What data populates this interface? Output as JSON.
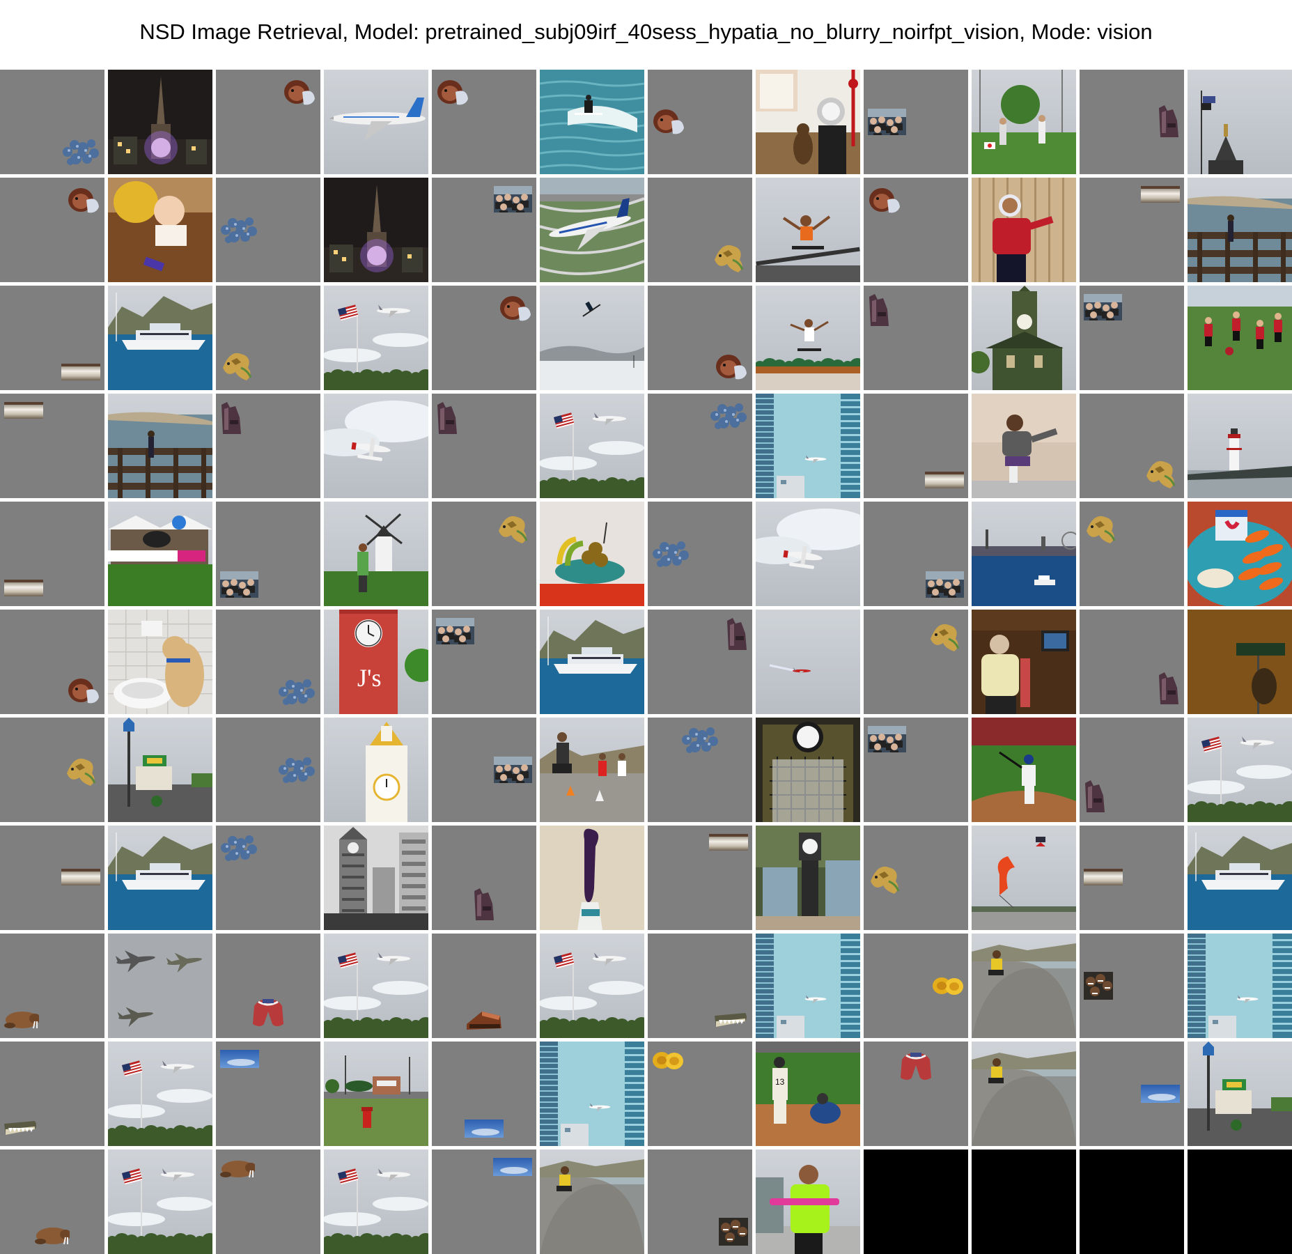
{
  "title": "NSD Image Retrieval, Model: pretrained_subj09irf_40sess_hypatia_no_blurry_noirfpt_vision, Mode: vision",
  "grid": {
    "rows": 11,
    "cols": 12,
    "cells": [
      {
        "kind": "stimulus",
        "obj": "blue-blob",
        "pos": "bottom-right"
      },
      {
        "kind": "retrieved",
        "scene": "night-spire"
      },
      {
        "kind": "stimulus",
        "obj": "baby-face",
        "pos": "top-right"
      },
      {
        "kind": "retrieved",
        "scene": "airliner-gray-sky"
      },
      {
        "kind": "stimulus",
        "obj": "baby-face",
        "pos": "top-left"
      },
      {
        "kind": "retrieved",
        "scene": "surfer-wave"
      },
      {
        "kind": "stimulus",
        "obj": "baby-face",
        "pos": "middle-left"
      },
      {
        "kind": "retrieved",
        "scene": "cat-clock-room"
      },
      {
        "kind": "stimulus",
        "obj": "crowd-photo",
        "pos": "middle-left"
      },
      {
        "kind": "retrieved",
        "scene": "frisbee-park"
      },
      {
        "kind": "stimulus",
        "obj": "maroon-shape",
        "pos": "middle-right"
      },
      {
        "kind": "retrieved",
        "scene": "flag-statue-sky"
      },
      {
        "kind": "stimulus",
        "obj": "baby-face",
        "pos": "top-right"
      },
      {
        "kind": "retrieved",
        "scene": "baby-floor"
      },
      {
        "kind": "stimulus",
        "obj": "blue-blob",
        "pos": "middle-left"
      },
      {
        "kind": "retrieved",
        "scene": "night-spire"
      },
      {
        "kind": "stimulus",
        "obj": "crowd-photo",
        "pos": "top-right"
      },
      {
        "kind": "retrieved",
        "scene": "airliner-runway"
      },
      {
        "kind": "stimulus",
        "obj": "gold-dragon",
        "pos": "bottom-right"
      },
      {
        "kind": "retrieved",
        "scene": "skateboarder-rail"
      },
      {
        "kind": "stimulus",
        "obj": "baby-face",
        "pos": "top-left"
      },
      {
        "kind": "retrieved",
        "scene": "boy-red-shirt"
      },
      {
        "kind": "stimulus",
        "obj": "metal-bar",
        "pos": "top-right"
      },
      {
        "kind": "retrieved",
        "scene": "person-fence-sea"
      },
      {
        "kind": "stimulus",
        "obj": "metal-bar",
        "pos": "bottom-right"
      },
      {
        "kind": "retrieved",
        "scene": "yacht-harbor"
      },
      {
        "kind": "stimulus",
        "obj": "gold-dragon",
        "pos": "bottom-left"
      },
      {
        "kind": "retrieved",
        "scene": "flag-plane-sky"
      },
      {
        "kind": "stimulus",
        "obj": "baby-face",
        "pos": "top-right"
      },
      {
        "kind": "retrieved",
        "scene": "skier-air"
      },
      {
        "kind": "stimulus",
        "obj": "baby-face",
        "pos": "bottom-right"
      },
      {
        "kind": "retrieved",
        "scene": "skateboard-beach"
      },
      {
        "kind": "stimulus",
        "obj": "maroon-shape",
        "pos": "top-left"
      },
      {
        "kind": "retrieved",
        "scene": "clock-tower-green"
      },
      {
        "kind": "stimulus",
        "obj": "crowd-photo",
        "pos": "top-left"
      },
      {
        "kind": "retrieved",
        "scene": "kids-soccer"
      },
      {
        "kind": "stimulus",
        "obj": "metal-bar",
        "pos": "top-left"
      },
      {
        "kind": "retrieved",
        "scene": "person-fence-sea"
      },
      {
        "kind": "stimulus",
        "obj": "maroon-shape",
        "pos": "top-left"
      },
      {
        "kind": "retrieved",
        "scene": "seaplane-clouds"
      },
      {
        "kind": "stimulus",
        "obj": "maroon-shape",
        "pos": "top-left"
      },
      {
        "kind": "retrieved",
        "scene": "flag-plane-sky"
      },
      {
        "kind": "stimulus",
        "obj": "blue-blob",
        "pos": "top-right"
      },
      {
        "kind": "retrieved",
        "scene": "skyscraper-plane"
      },
      {
        "kind": "stimulus",
        "obj": "metal-bar",
        "pos": "bottom-right"
      },
      {
        "kind": "retrieved",
        "scene": "woman-hydrant"
      },
      {
        "kind": "stimulus",
        "obj": "gold-dragon",
        "pos": "bottom-right"
      },
      {
        "kind": "retrieved",
        "scene": "lighthouse-pier"
      },
      {
        "kind": "stimulus",
        "obj": "metal-bar",
        "pos": "bottom-left"
      },
      {
        "kind": "retrieved",
        "scene": "tent-field"
      },
      {
        "kind": "stimulus",
        "obj": "crowd-photo",
        "pos": "bottom-left"
      },
      {
        "kind": "retrieved",
        "scene": "windmill-field"
      },
      {
        "kind": "stimulus",
        "obj": "gold-dragon",
        "pos": "top-right"
      },
      {
        "kind": "retrieved",
        "scene": "fruit-bowl"
      },
      {
        "kind": "stimulus",
        "obj": "blue-blob",
        "pos": "middle-left"
      },
      {
        "kind": "retrieved",
        "scene": "seaplane-clouds"
      },
      {
        "kind": "stimulus",
        "obj": "crowd-photo",
        "pos": "bottom-right"
      },
      {
        "kind": "retrieved",
        "scene": "river-city"
      },
      {
        "kind": "stimulus",
        "obj": "gold-dragon",
        "pos": "top-left"
      },
      {
        "kind": "retrieved",
        "scene": "yogurt-carrots"
      },
      {
        "kind": "stimulus",
        "obj": "baby-face",
        "pos": "bottom-right"
      },
      {
        "kind": "retrieved",
        "scene": "dog-toilet"
      },
      {
        "kind": "stimulus",
        "obj": "blue-blob",
        "pos": "bottom-right"
      },
      {
        "kind": "retrieved",
        "scene": "red-clock-tower"
      },
      {
        "kind": "stimulus",
        "obj": "crowd-photo",
        "pos": "top-left"
      },
      {
        "kind": "retrieved",
        "scene": "yacht-harbor"
      },
      {
        "kind": "stimulus",
        "obj": "maroon-shape",
        "pos": "top-right"
      },
      {
        "kind": "retrieved",
        "scene": "plane-smoke-sky"
      },
      {
        "kind": "stimulus",
        "obj": "gold-dragon",
        "pos": "top-right"
      },
      {
        "kind": "retrieved",
        "scene": "woman-room"
      },
      {
        "kind": "stimulus",
        "obj": "maroon-shape",
        "pos": "bottom-right"
      },
      {
        "kind": "retrieved",
        "scene": "street-sign-night"
      },
      {
        "kind": "stimulus",
        "obj": "gold-dragon",
        "pos": "middle-right"
      },
      {
        "kind": "retrieved",
        "scene": "green-building-lot"
      },
      {
        "kind": "stimulus",
        "obj": "blue-blob",
        "pos": "middle-right"
      },
      {
        "kind": "retrieved",
        "scene": "white-clock-tower"
      },
      {
        "kind": "stimulus",
        "obj": "crowd-photo",
        "pos": "middle-right"
      },
      {
        "kind": "retrieved",
        "scene": "skateboard-park"
      },
      {
        "kind": "stimulus",
        "obj": "blue-blob",
        "pos": "top-middle"
      },
      {
        "kind": "retrieved",
        "scene": "station-clock"
      },
      {
        "kind": "stimulus",
        "obj": "crowd-photo",
        "pos": "top-left"
      },
      {
        "kind": "retrieved",
        "scene": "baseball-batter"
      },
      {
        "kind": "stimulus",
        "obj": "maroon-shape",
        "pos": "bottom-left"
      },
      {
        "kind": "retrieved",
        "scene": "flag-plane-sky"
      },
      {
        "kind": "stimulus",
        "obj": "metal-bar",
        "pos": "middle-right"
      },
      {
        "kind": "retrieved",
        "scene": "yacht-harbor"
      },
      {
        "kind": "stimulus",
        "obj": "blue-blob",
        "pos": "top-left"
      },
      {
        "kind": "retrieved",
        "scene": "bw-tower-city"
      },
      {
        "kind": "stimulus",
        "obj": "maroon-shape",
        "pos": "bottom-middle"
      },
      {
        "kind": "retrieved",
        "scene": "purple-object"
      },
      {
        "kind": "stimulus",
        "obj": "metal-bar",
        "pos": "top-right"
      },
      {
        "kind": "retrieved",
        "scene": "street-clock"
      },
      {
        "kind": "stimulus",
        "obj": "gold-dragon",
        "pos": "middle-left"
      },
      {
        "kind": "retrieved",
        "scene": "kite-beach"
      },
      {
        "kind": "stimulus",
        "obj": "metal-bar",
        "pos": "middle-left"
      },
      {
        "kind": "retrieved",
        "scene": "yacht-harbor"
      },
      {
        "kind": "stimulus",
        "obj": "walrus",
        "pos": "bottom-left"
      },
      {
        "kind": "retrieved",
        "scene": "jets-gray"
      },
      {
        "kind": "stimulus",
        "obj": "red-cloth",
        "pos": "bottom-middle"
      },
      {
        "kind": "retrieved",
        "scene": "flag-plane-sky"
      },
      {
        "kind": "stimulus",
        "obj": "roof-tile",
        "pos": "bottom-middle"
      },
      {
        "kind": "retrieved",
        "scene": "flag-plane-sky"
      },
      {
        "kind": "stimulus",
        "obj": "crocodile",
        "pos": "bottom-right"
      },
      {
        "kind": "retrieved",
        "scene": "skyscraper-plane"
      },
      {
        "kind": "stimulus",
        "obj": "yellow-fruit",
        "pos": "middle-right"
      },
      {
        "kind": "retrieved",
        "scene": "skate-bowl"
      },
      {
        "kind": "stimulus",
        "obj": "faces-group",
        "pos": "middle-left"
      },
      {
        "kind": "retrieved",
        "scene": "skyscraper-plane"
      },
      {
        "kind": "stimulus",
        "obj": "crocodile",
        "pos": "bottom-left"
      },
      {
        "kind": "retrieved",
        "scene": "flag-plane-sky"
      },
      {
        "kind": "stimulus",
        "obj": "blue-sky-strip",
        "pos": "top-left"
      },
      {
        "kind": "retrieved",
        "scene": "hydrant-lawn"
      },
      {
        "kind": "stimulus",
        "obj": "blue-sky-strip",
        "pos": "bottom-middle"
      },
      {
        "kind": "retrieved",
        "scene": "skyscraper-plane"
      },
      {
        "kind": "stimulus",
        "obj": "yellow-fruit",
        "pos": "top-left"
      },
      {
        "kind": "retrieved",
        "scene": "baseball-catcher"
      },
      {
        "kind": "stimulus",
        "obj": "red-cloth",
        "pos": "top-middle"
      },
      {
        "kind": "retrieved",
        "scene": "skate-bowl"
      },
      {
        "kind": "stimulus",
        "obj": "blue-sky-strip",
        "pos": "middle-right"
      },
      {
        "kind": "retrieved",
        "scene": "green-building-lot"
      },
      {
        "kind": "stimulus",
        "obj": "walrus",
        "pos": "bottom-middle"
      },
      {
        "kind": "retrieved",
        "scene": "flag-plane-sky"
      },
      {
        "kind": "stimulus",
        "obj": "walrus",
        "pos": "top-left"
      },
      {
        "kind": "retrieved",
        "scene": "flag-plane-sky"
      },
      {
        "kind": "stimulus",
        "obj": "blue-sky-strip",
        "pos": "top-right"
      },
      {
        "kind": "retrieved",
        "scene": "skate-bowl"
      },
      {
        "kind": "stimulus",
        "obj": "faces-group",
        "pos": "bottom-right"
      },
      {
        "kind": "retrieved",
        "scene": "man-green-hoodie"
      },
      {
        "kind": "empty"
      },
      {
        "kind": "empty"
      },
      {
        "kind": "empty"
      },
      {
        "kind": "empty"
      }
    ]
  },
  "palette": {
    "stimulus_bg": "#7f7f7f",
    "empty_bg": "#000000",
    "page_bg": "#ffffff"
  }
}
